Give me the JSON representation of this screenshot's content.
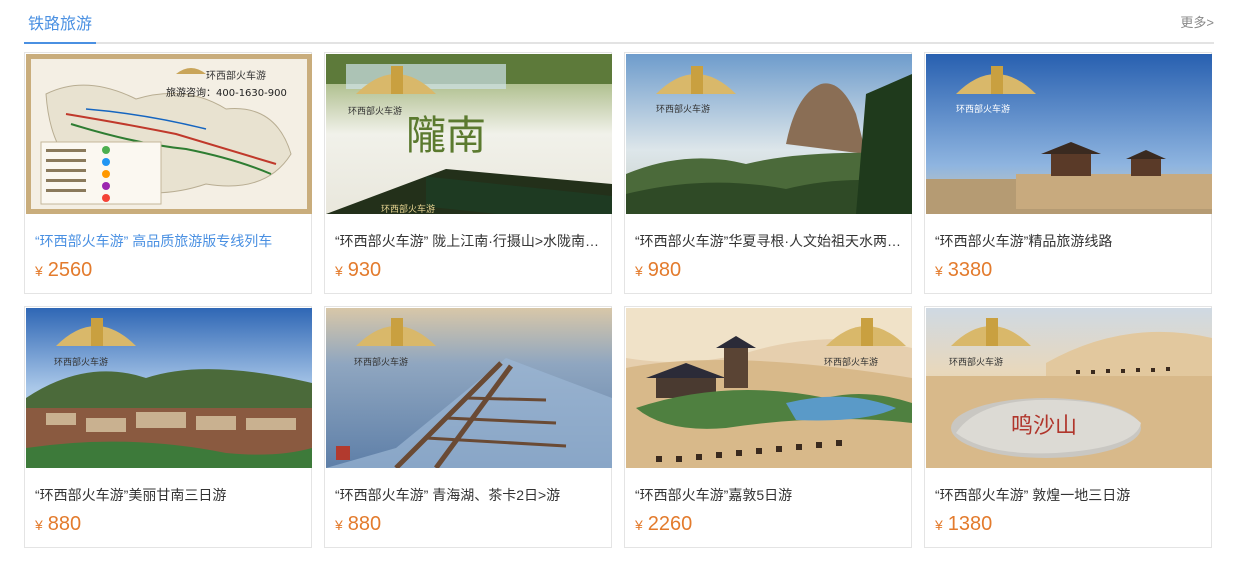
{
  "header": {
    "title": "铁路旅游",
    "more": "更多>"
  },
  "currency": "¥",
  "logo_text": "环西部火车游",
  "cards": [
    {
      "title": "“环西部火车游” 高品质旅游版专线列车",
      "price": "2560",
      "map_hotline": "旅游咨询：400-1630-900"
    },
    {
      "title": "“环西部火车游” 陇上江南·行摄山>水陇南…",
      "price": "930",
      "overlay": "隴南"
    },
    {
      "title": "“环西部火车游”华夏寻根·人文始祖天水两…",
      "price": "980"
    },
    {
      "title": "“环西部火车游”精品旅游线路",
      "price": "3380"
    },
    {
      "title": "“环西部火车游”美丽甘南三日游",
      "price": "880"
    },
    {
      "title": "“环西部火车游” 青海湖、茶卡2日>游",
      "price": "880"
    },
    {
      "title": "“环西部火车游”嘉敦5日游",
      "price": "2260"
    },
    {
      "title": "“环西部火车游” 敦煌一地三日游",
      "price": "1380",
      "rock_text": "鸣沙山"
    }
  ]
}
